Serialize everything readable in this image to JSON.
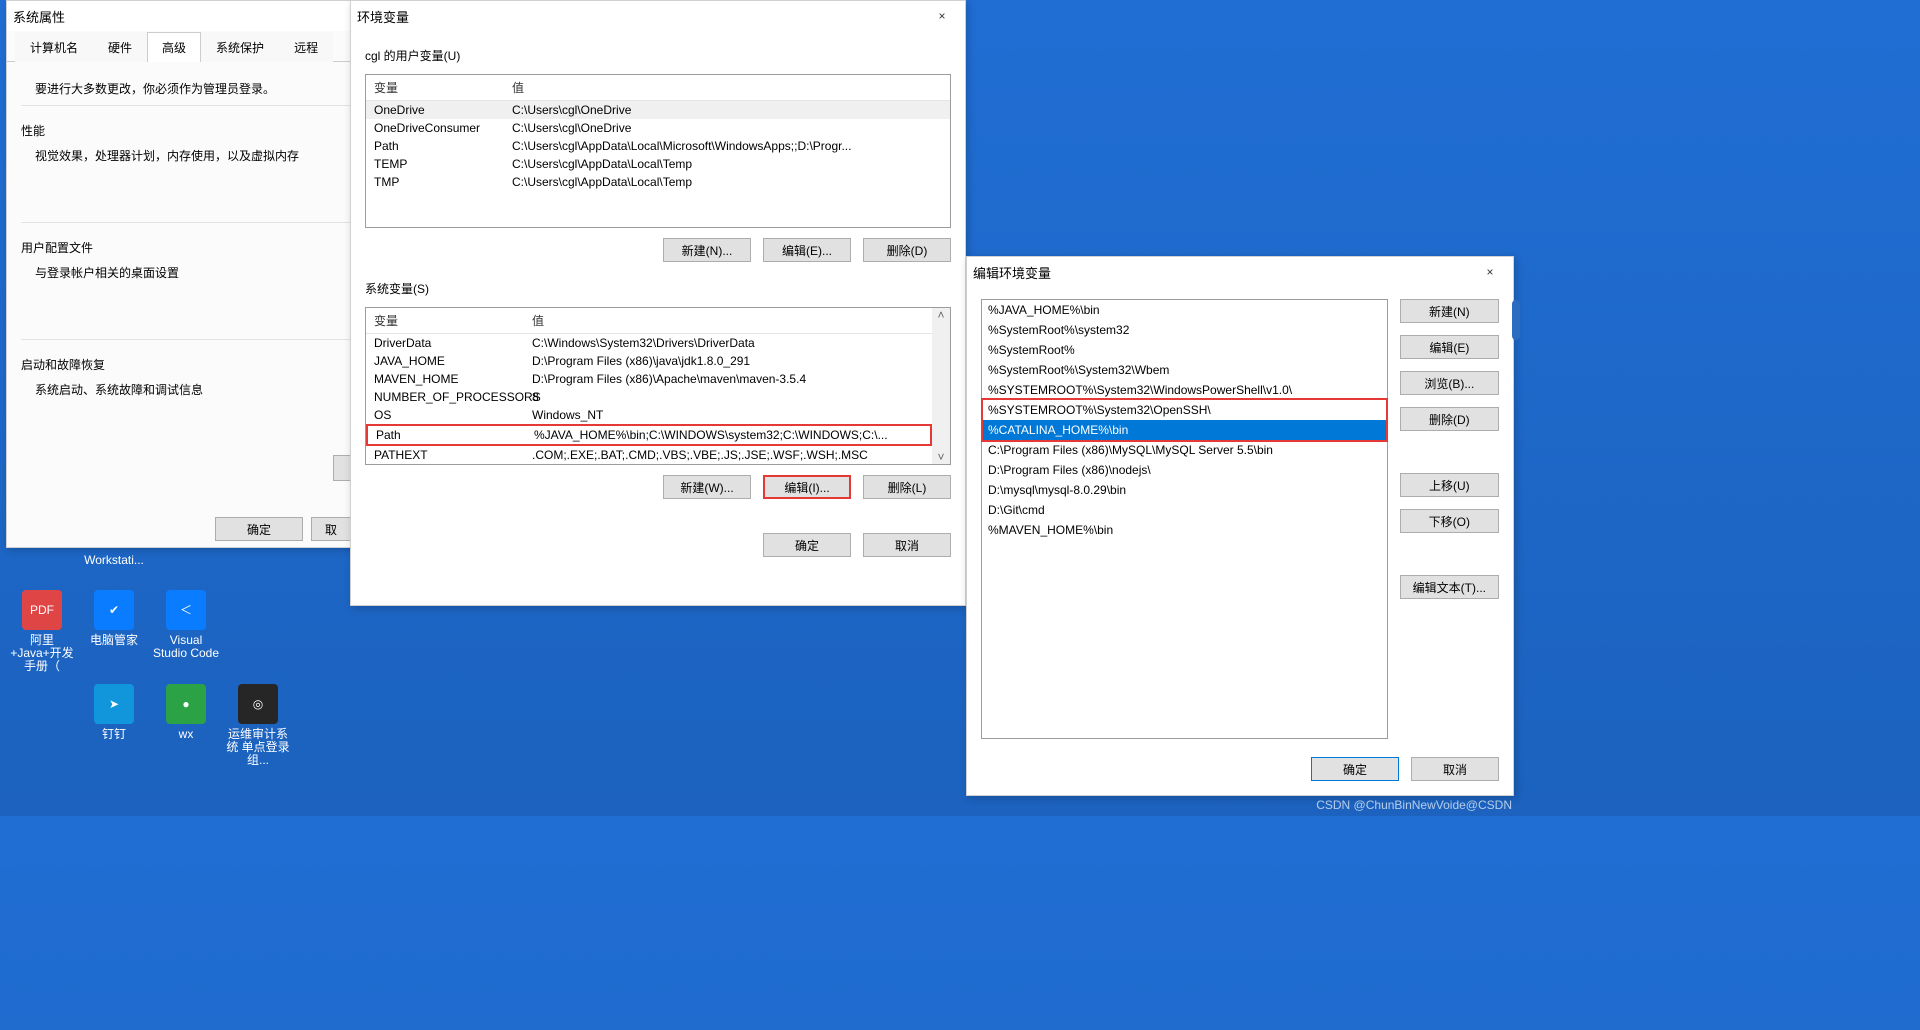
{
  "desktop": {
    "icons": [
      {
        "label": "Workstati...",
        "bg": "#4aa3ff"
      },
      {
        "label": "阿里+Java+开发手册（",
        "bg": "#e04545",
        "glyph": "PDF"
      },
      {
        "label": "电脑管家",
        "bg": "#0a7cff",
        "glyph": "✔"
      },
      {
        "label": "Visual Studio Code",
        "bg": "#0a7cff",
        "glyph": "＜"
      },
      {
        "label": "钉钉",
        "bg": "#1296db",
        "glyph": "➤"
      },
      {
        "label": "wx",
        "bg": "#2ba245",
        "glyph": "●"
      },
      {
        "label": "运维审计系统 单点登录组...",
        "bg": "#262626",
        "glyph": "◎"
      }
    ]
  },
  "sysprops": {
    "title": "系统属性",
    "tabs": [
      "计算机名",
      "硬件",
      "高级",
      "系统保护",
      "远程"
    ],
    "active_tab": 2,
    "note": "要进行大多数更改，你必须作为管理员登录。",
    "perf_label": "性能",
    "perf_desc": "视觉效果，处理器计划，内存使用，以及虚拟内存",
    "profiles_label": "用户配置文件",
    "profiles_desc": "与登录帐户相关的桌面设置",
    "startup_label": "启动和故障恢复",
    "startup_desc": "系统启动、系统故障和调试信息",
    "btn_ok": "确定",
    "btn_cancel_vis": "取"
  },
  "envvars": {
    "title": "环境变量",
    "close": "×",
    "user_group": "cgl 的用户变量(U)",
    "sys_group": "系统变量(S)",
    "col_var": "变量",
    "col_val": "值",
    "user_rows": [
      {
        "v": "OneDrive",
        "val": "C:\\Users\\cgl\\OneDrive",
        "sel": true
      },
      {
        "v": "OneDriveConsumer",
        "val": "C:\\Users\\cgl\\OneDrive"
      },
      {
        "v": "Path",
        "val": "C:\\Users\\cgl\\AppData\\Local\\Microsoft\\WindowsApps;;D:\\Progr..."
      },
      {
        "v": "TEMP",
        "val": "C:\\Users\\cgl\\AppData\\Local\\Temp"
      },
      {
        "v": "TMP",
        "val": "C:\\Users\\cgl\\AppData\\Local\\Temp"
      }
    ],
    "sys_rows": [
      {
        "v": "DriverData",
        "val": "C:\\Windows\\System32\\Drivers\\DriverData"
      },
      {
        "v": "JAVA_HOME",
        "val": "D:\\Program Files (x86)\\java\\jdk1.8.0_291"
      },
      {
        "v": "MAVEN_HOME",
        "val": "D:\\Program Files (x86)\\Apache\\maven\\maven-3.5.4"
      },
      {
        "v": "NUMBER_OF_PROCESSORS",
        "val": "8"
      },
      {
        "v": "OS",
        "val": "Windows_NT"
      },
      {
        "v": "Path",
        "val": "%JAVA_HOME%\\bin;C:\\WINDOWS\\system32;C:\\WINDOWS;C:\\...",
        "hl": true
      },
      {
        "v": "PATHEXT",
        "val": ".COM;.EXE;.BAT;.CMD;.VBS;.VBE;.JS;.JSE;.WSF;.WSH;.MSC"
      }
    ],
    "btn_new_n": "新建(N)...",
    "btn_edit_e": "编辑(E)...",
    "btn_del_d": "删除(D)",
    "btn_new_w": "新建(W)...",
    "btn_edit_i": "编辑(I)...",
    "btn_del_l": "删除(L)",
    "btn_ok": "确定",
    "btn_cancel": "取消",
    "up": "˄",
    "dn": "˅"
  },
  "editenv": {
    "title": "编辑环境变量",
    "close": "×",
    "paths": [
      "%JAVA_HOME%\\bin",
      "%SystemRoot%\\system32",
      "%SystemRoot%",
      "%SystemRoot%\\System32\\Wbem",
      "%SYSTEMROOT%\\System32\\WindowsPowerShell\\v1.0\\",
      "%SYSTEMROOT%\\System32\\OpenSSH\\",
      "%CATALINA_HOME%\\bin",
      "C:\\Program Files (x86)\\MySQL\\MySQL Server 5.5\\bin",
      "D:\\Program Files (x86)\\nodejs\\",
      "D:\\mysql\\mysql-8.0.29\\bin",
      "D:\\Git\\cmd",
      "%MAVEN_HOME%\\bin"
    ],
    "selected_index": 6,
    "highlight_box": true,
    "btn_new": "新建(N)",
    "btn_edit": "编辑(E)",
    "btn_browse": "浏览(B)...",
    "btn_del": "删除(D)",
    "btn_up": "上移(U)",
    "btn_down": "下移(O)",
    "btn_edit_text": "编辑文本(T)...",
    "btn_ok": "确定",
    "btn_cancel": "取消"
  },
  "watermark": "CSDN @ChunBinNewVoide@CSDN"
}
